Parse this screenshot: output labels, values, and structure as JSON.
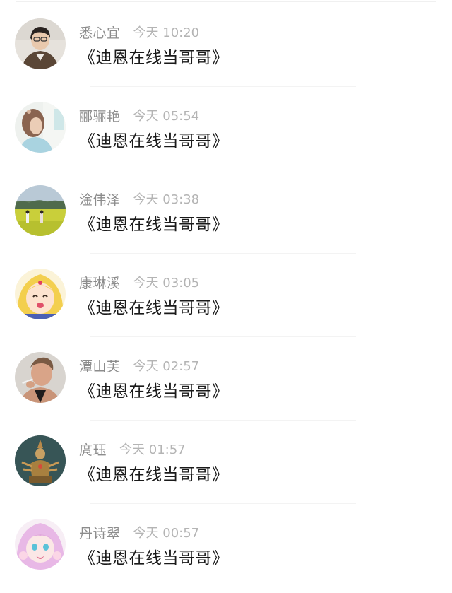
{
  "comments": [
    {
      "name": "悉心宜",
      "time": "今天 10:20",
      "message": "《迪恩在线当哥哥》",
      "avatar_icon": "avatar-woman-glasses"
    },
    {
      "name": "郦骊艳",
      "time": "今天 05:54",
      "message": "《迪恩在线当哥哥》",
      "avatar_icon": "avatar-girl-blue-shirt"
    },
    {
      "name": "淦伟泽",
      "time": "今天 03:38",
      "message": "《迪恩在线当哥哥》",
      "avatar_icon": "avatar-field-landscape"
    },
    {
      "name": "康琳溪",
      "time": "今天 03:05",
      "message": "《迪恩在线当哥哥》",
      "avatar_icon": "avatar-anime-blonde"
    },
    {
      "name": "潭山芙",
      "time": "今天 02:57",
      "message": "《迪恩在线当哥哥》",
      "avatar_icon": "avatar-man-cigarette"
    },
    {
      "name": "庹珏",
      "time": "今天 01:57",
      "message": "《迪恩在线当哥哥》",
      "avatar_icon": "avatar-statue"
    },
    {
      "name": "丹诗翠",
      "time": "今天 00:57",
      "message": "《迪恩在线当哥哥》",
      "avatar_icon": "avatar-anime-pink"
    }
  ],
  "colors": {
    "name": "#8c8c8c",
    "time": "#b4b4b4",
    "message": "#1a1a1a",
    "divider": "#f3f3f3"
  }
}
